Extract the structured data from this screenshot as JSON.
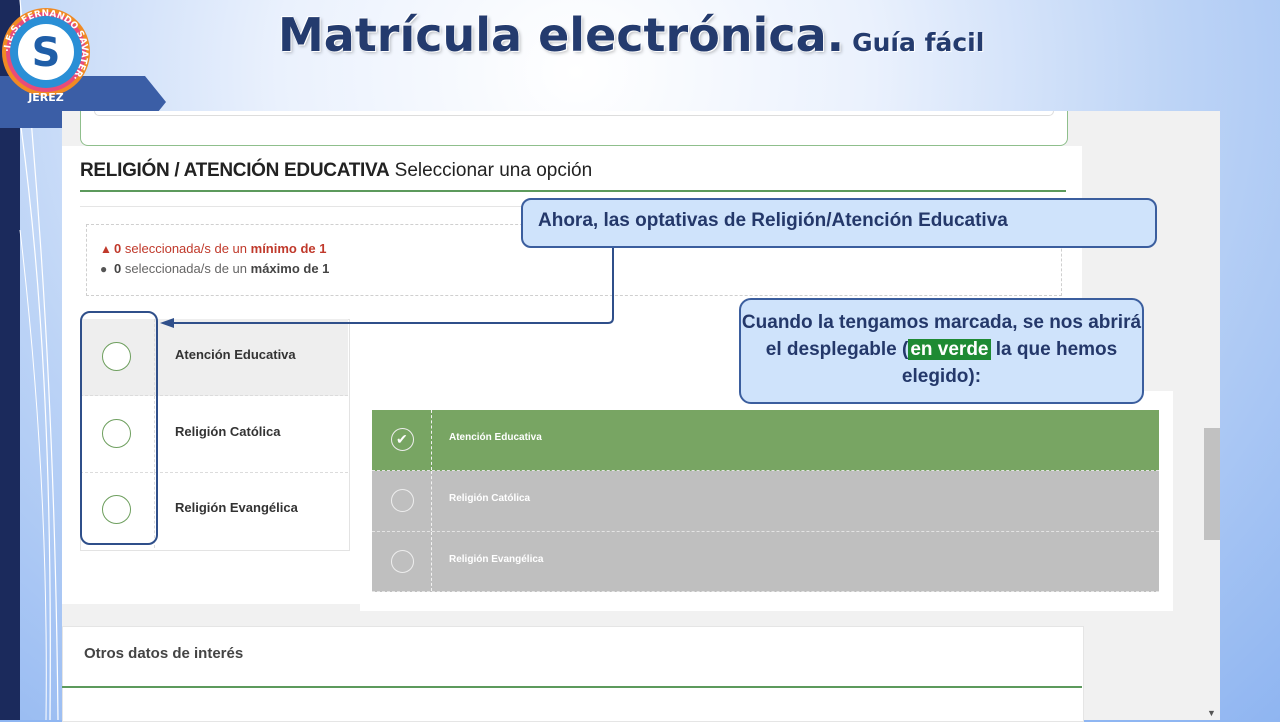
{
  "slide": {
    "title_main": "Matrícula electrónica.",
    "title_sub": "Guía fácil",
    "logo_text_ring": "·I.E.S. FERNANDO SAVATER·",
    "logo_letter": "S",
    "logo_city": "JEREZ"
  },
  "section": {
    "title_bold": "RELIGIÓN / ATENCIÓN EDUCATIVA",
    "title_regular": "Seleccionar una opción",
    "min_count": "0",
    "min_text": "seleccionada/s de un",
    "min_label": "mínimo de 1",
    "max_count": "0",
    "max_text": "seleccionada/s de un",
    "max_label": "máximo de 1"
  },
  "options": [
    {
      "label": "Atención Educativa"
    },
    {
      "label": "Religión Católica"
    },
    {
      "label": "Religión Evangélica"
    }
  ],
  "dropdown": [
    {
      "label": "Atención Educativa",
      "selected": true
    },
    {
      "label": "Religión Católica",
      "selected": false
    },
    {
      "label": "Religión Evangélica",
      "selected": false
    }
  ],
  "other": {
    "title": "Otros datos de interés"
  },
  "callouts": {
    "first": "Ahora, las optativas de Religión/Atención Educativa",
    "second_a": "Cuando la tengamos marcada, se nos abrirá el desplegable (",
    "second_green": "en verde",
    "second_b": " la que hemos elegido):"
  },
  "colors": {
    "selected_green": "#78a563",
    "unselected_gray": "#bfbfbf",
    "callout_border": "#3b5e9e",
    "title_blue": "#243b6e"
  }
}
